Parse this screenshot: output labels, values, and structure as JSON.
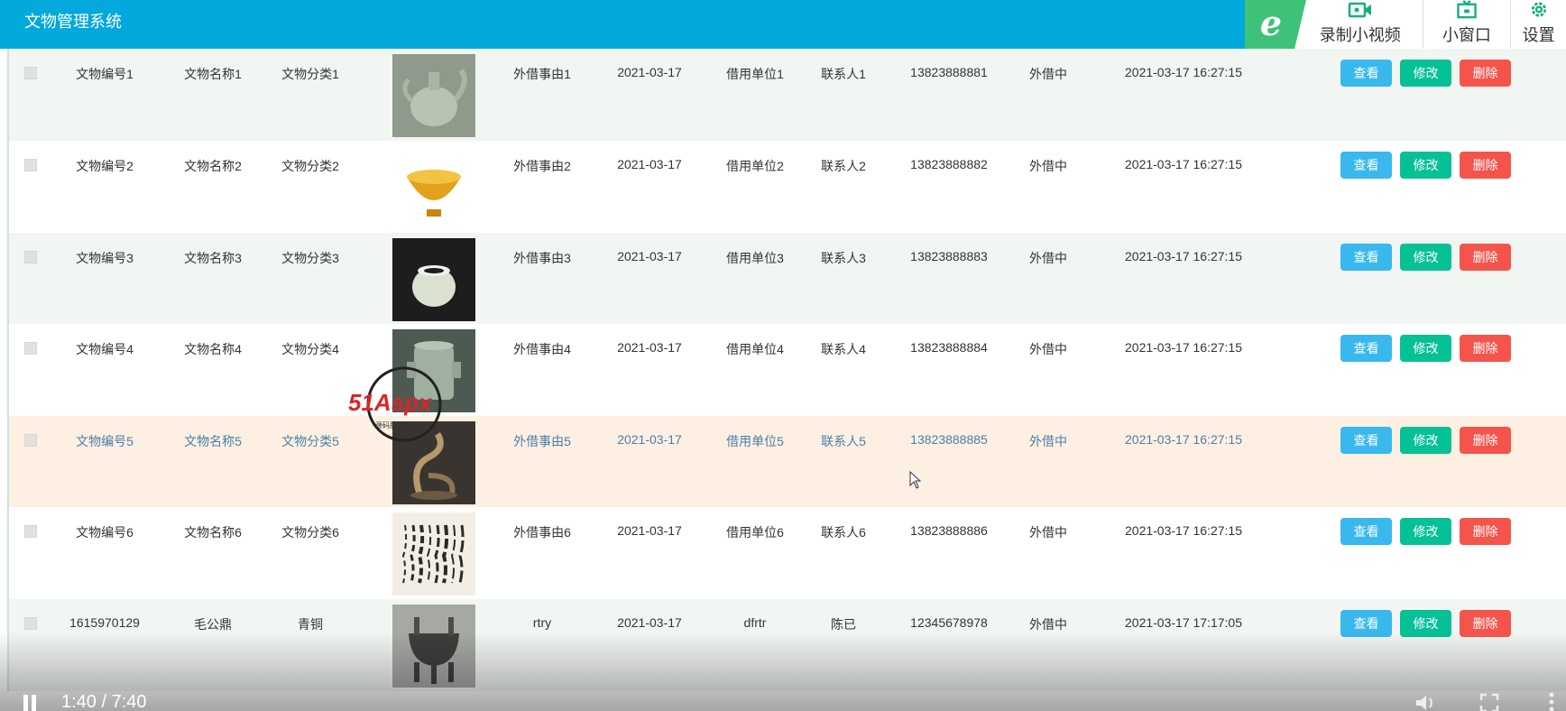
{
  "app": {
    "title": "文物管理系统"
  },
  "overlay_toolbar": {
    "record_label": "录制小视频",
    "mini_window_label": "小窗口",
    "settings_label": "设置",
    "ie_glyph": "e"
  },
  "buttons": {
    "view": "查看",
    "edit": "修改",
    "delete": "删除"
  },
  "rows": [
    {
      "code": "文物编号1",
      "name": "文物名称1",
      "category": "文物分类1",
      "image": "celadon-ewer",
      "reason": "外借事由1",
      "date": "2021-03-17",
      "borrower": "借用单位1",
      "contact": "联系人1",
      "phone": "13823888881",
      "status": "外借中",
      "created": "2021-03-17 16:27:15"
    },
    {
      "code": "文物编号2",
      "name": "文物名称2",
      "category": "文物分类2",
      "image": "gold-bowl",
      "reason": "外借事由2",
      "date": "2021-03-17",
      "borrower": "借用单位2",
      "contact": "联系人2",
      "phone": "13823888882",
      "status": "外借中",
      "created": "2021-03-17 16:27:15"
    },
    {
      "code": "文物编号3",
      "name": "文物名称3",
      "category": "文物分类3",
      "image": "jade-jar",
      "reason": "外借事由3",
      "date": "2021-03-17",
      "borrower": "借用单位3",
      "contact": "联系人3",
      "phone": "13823888883",
      "status": "外借中",
      "created": "2021-03-17 16:27:15"
    },
    {
      "code": "文物编号4",
      "name": "文物名称4",
      "category": "文物分类4",
      "image": "jade-vessel",
      "reason": "外借事由4",
      "date": "2021-03-17",
      "borrower": "借用单位4",
      "contact": "联系人4",
      "phone": "13823888884",
      "status": "外借中",
      "created": "2021-03-17 16:27:15"
    },
    {
      "code": "文物编号5",
      "name": "文物名称5",
      "category": "文物分类5",
      "image": "bronze-dragon",
      "reason": "外借事由5",
      "date": "2021-03-17",
      "borrower": "借用单位5",
      "contact": "联系人5",
      "phone": "13823888885",
      "status": "外借中",
      "created": "2021-03-17 16:27:15"
    },
    {
      "code": "文物编号6",
      "name": "文物名称6",
      "category": "文物分类6",
      "image": "calligraphy",
      "reason": "外借事由6",
      "date": "2021-03-17",
      "borrower": "借用单位6",
      "contact": "联系人6",
      "phone": "13823888886",
      "status": "外借中",
      "created": "2021-03-17 16:27:15"
    },
    {
      "code": "1615970129",
      "name": "毛公鼎",
      "category": "青铜",
      "image": "bronze-ding",
      "reason": "rtry",
      "date": "2021-03-17",
      "borrower": "dfrtr",
      "contact": "陈已",
      "phone": "12345678978",
      "status": "外借中",
      "created": "2021-03-17 17:17:05"
    }
  ],
  "watermark": {
    "brand": "51Aspx",
    "tagline": "源码服务专家"
  },
  "video": {
    "time": "1:40 / 7:40"
  },
  "colors": {
    "header": "#03a8dc",
    "view": "#39b8ee",
    "edit": "#06c196",
    "delete": "#f5544d",
    "hover_row": "#fdf0e3"
  }
}
